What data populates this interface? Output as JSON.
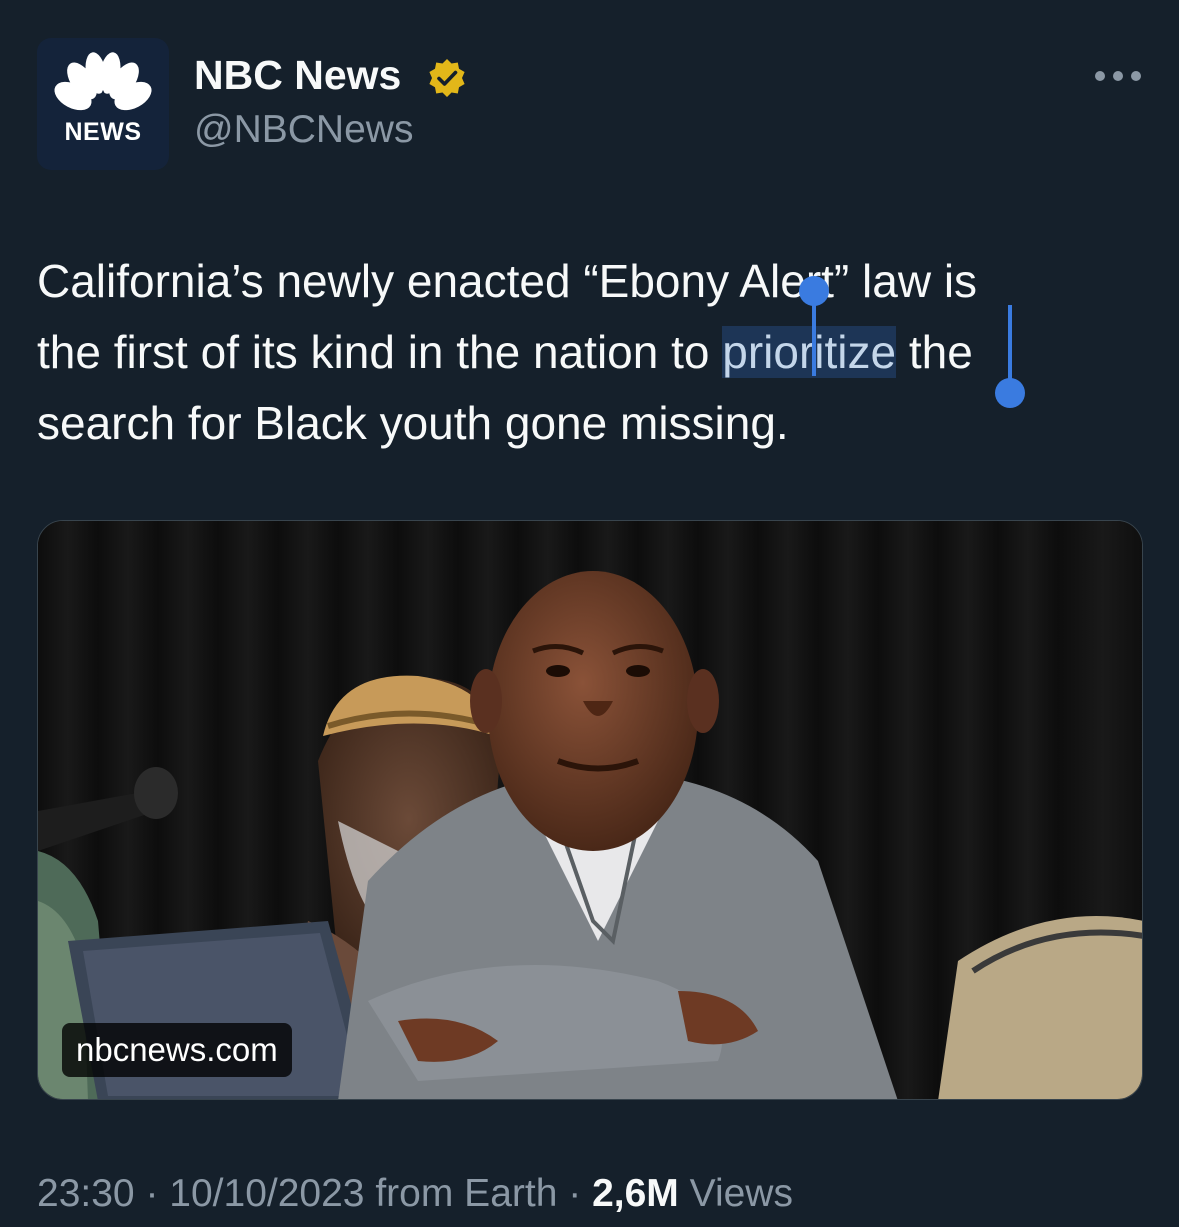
{
  "account": {
    "display_name": "NBC News",
    "handle": "@NBCNews",
    "avatar_text": "NEWS",
    "verified_badge_color": "#e2b719"
  },
  "tweet": {
    "line1_pre": "California’s newly enacted “Ebony Alert” law is",
    "line2_pre": "the first of its kind in the nation to ",
    "line2_selected": "prioritize",
    "line2_post": " the",
    "line3": "search for Black youth gone missing."
  },
  "media": {
    "source": "nbcnews.com"
  },
  "meta": {
    "time": "23:30",
    "date": "10/10/2023",
    "from": "from Earth",
    "views_count": "2,6M",
    "views_label": "Views",
    "separator": "·"
  },
  "colors": {
    "background": "#15202b",
    "text_primary": "#f7f9f9",
    "text_secondary": "#8b98a5",
    "selection_handle": "#3a7be0"
  },
  "icons": [
    "nbc-peacock-icon",
    "verified-badge-icon",
    "more-options-icon"
  ]
}
